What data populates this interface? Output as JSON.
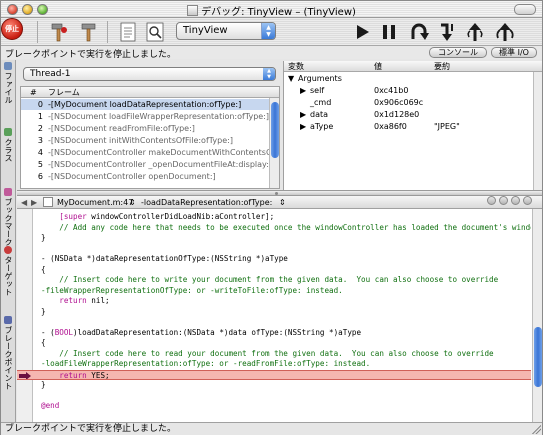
{
  "window": {
    "title": "デバッグ: TinyView – (TinyView)"
  },
  "toolbar": {
    "stop_label": "停止",
    "target": "TinyView",
    "icons": [
      "hammer-icon",
      "build-icon",
      "inspector-icon",
      "search-icon",
      "continue-icon",
      "pause-icon",
      "step-over-icon",
      "step-into-icon",
      "step-out-icon"
    ]
  },
  "status_top": {
    "text": "ブレークポイントで実行を停止しました。",
    "console_tab": "コンソール",
    "stdio_tab": "標準 I/O"
  },
  "drawer": {
    "items": [
      "ファイル",
      "クラス",
      "ブックマーク",
      "ターゲット",
      "ブレークポイント"
    ]
  },
  "threads": {
    "selected": "Thread-1"
  },
  "frames": {
    "headers": [
      "#",
      "フレーム"
    ],
    "rows": [
      {
        "num": "0",
        "name": "-[MyDocument loadDataRepresentation:ofType:]"
      },
      {
        "num": "1",
        "name": "-[NSDocument loadFileWrapperRepresentation:ofType:]"
      },
      {
        "num": "2",
        "name": "-[NSDocument readFromFile:ofType:]"
      },
      {
        "num": "3",
        "name": "-[NSDocument initWithContentsOfFile:ofType:]"
      },
      {
        "num": "4",
        "name": "-[NSDocumentController makeDocumentWithContentsOfFi"
      },
      {
        "num": "5",
        "name": "-[NSDocumentController _openDocumentFileAt:display:]"
      },
      {
        "num": "6",
        "name": "-[NSDocumentController openDocument:]"
      }
    ]
  },
  "variables": {
    "headers": [
      "変数",
      "値",
      "要約"
    ],
    "group": "Arguments",
    "rows": [
      {
        "name": "self",
        "value": "0xc41b0",
        "summary": "",
        "expandable": true
      },
      {
        "name": "_cmd",
        "value": "0x906c069c",
        "summary": "",
        "expandable": false
      },
      {
        "name": "data",
        "value": "0x1d128e0",
        "summary": "",
        "expandable": true
      },
      {
        "name": "aType",
        "value": "0xa86f0",
        "summary": "\"JPEG\"",
        "expandable": true
      }
    ]
  },
  "editor": {
    "file": "MyDocument.m:47",
    "function": "-loadDataRepresentation:ofType:",
    "lines": [
      [
        {
          "c": "kw",
          "t": "    [super "
        },
        {
          "c": "",
          "t": "windowControllerDidLoadNib:aController];"
        }
      ],
      [
        {
          "c": "cm",
          "t": "    // Add any code here that needs to be executed once the windowController has loaded the document's window."
        }
      ],
      [
        {
          "c": "",
          "t": "}"
        }
      ],
      [
        {
          "c": "",
          "t": ""
        }
      ],
      [
        {
          "c": "",
          "t": "- (NSData *)dataRepresentationOfType:(NSString *)aType"
        }
      ],
      [
        {
          "c": "",
          "t": "{"
        }
      ],
      [
        {
          "c": "cm",
          "t": "    // Insert code here to write your document from the given data.  You can also choose to override"
        }
      ],
      [
        {
          "c": "cm",
          "t": "-fileWrapperRepresentationOfType: or -writeToFile:ofType: instead."
        }
      ],
      [
        {
          "c": "kw",
          "t": "    return "
        },
        {
          "c": "",
          "t": "nil;"
        }
      ],
      [
        {
          "c": "",
          "t": "}"
        }
      ],
      [
        {
          "c": "",
          "t": ""
        }
      ],
      [
        {
          "c": "",
          "t": "- ("
        },
        {
          "c": "kw",
          "t": "BOOL"
        },
        {
          "c": "",
          "t": ")loadDataRepresentation:(NSData *)data ofType:(NSString *)aType"
        }
      ],
      [
        {
          "c": "",
          "t": "{"
        }
      ],
      [
        {
          "c": "cm",
          "t": "    // Insert code here to read your document from the given data.  You can also choose to override"
        }
      ],
      [
        {
          "c": "cm",
          "t": "-loadFileWrapperRepresentation:ofType: or -readFromFile:ofType: instead."
        }
      ],
      [
        {
          "c": "kw",
          "t": "    return "
        },
        {
          "c": "",
          "t": "YES;"
        }
      ],
      [
        {
          "c": "",
          "t": "}"
        }
      ],
      [
        {
          "c": "",
          "t": ""
        }
      ],
      [
        {
          "c": "kw",
          "t": "@end"
        }
      ]
    ],
    "current_line_index": 15
  },
  "status_bottom": {
    "text": "ブレークポイントで実行を停止しました。"
  },
  "colors": {
    "selection": "#c7d7ef",
    "current_line": "#f5b6b0",
    "keyword": "#b01090",
    "comment": "#107010"
  }
}
